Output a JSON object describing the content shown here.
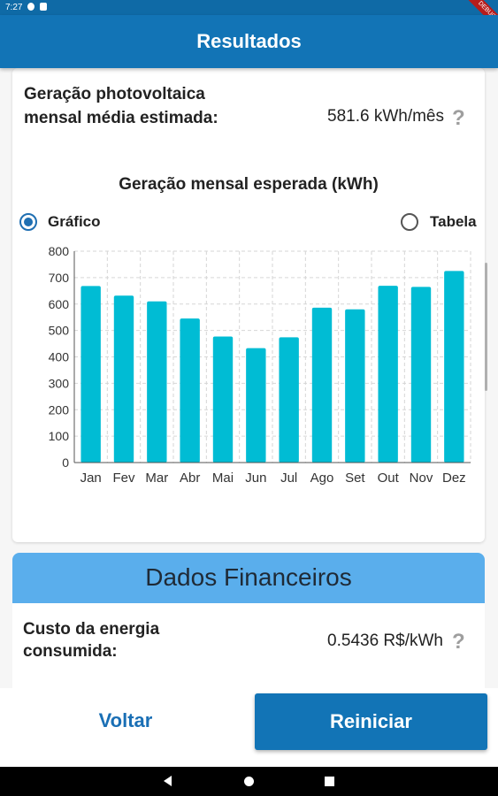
{
  "status_bar": {
    "time": "7:27",
    "ribbon": "DEBUG"
  },
  "app_bar": {
    "title": "Resultados"
  },
  "generation": {
    "label": "Geração photovoltaica mensal média estimada:",
    "value": "581.6 kWh/mês"
  },
  "chart_section": {
    "title": "Geração mensal esperada (kWh)",
    "radio_chart": "Gráfico",
    "radio_table": "Tabela",
    "selected": "Gráfico"
  },
  "chart_data": {
    "type": "bar",
    "title": "Geração mensal esperada (kWh)",
    "categories": [
      "Jan",
      "Fev",
      "Mar",
      "Abr",
      "Mai",
      "Jun",
      "Jul",
      "Ago",
      "Set",
      "Out",
      "Nov",
      "Dez"
    ],
    "values": [
      668,
      632,
      610,
      545,
      477,
      433,
      474,
      586,
      580,
      669,
      665,
      725
    ],
    "ylim": [
      0,
      800
    ],
    "yticks": [
      0,
      100,
      200,
      300,
      400,
      500,
      600,
      700,
      800
    ],
    "grid": true,
    "bar_color": "#00bcd4"
  },
  "financial": {
    "header": "Dados Financeiros",
    "cost_label": "Custo da energia consumida:",
    "cost_value": "0.5436 R$/kWh"
  },
  "buttons": {
    "back": "Voltar",
    "restart": "Reiniciar"
  },
  "help_icon_glyph": "?",
  "colors": {
    "primary": "#1274b6",
    "accent_header": "#5aaeec",
    "bar": "#00bcd4"
  }
}
